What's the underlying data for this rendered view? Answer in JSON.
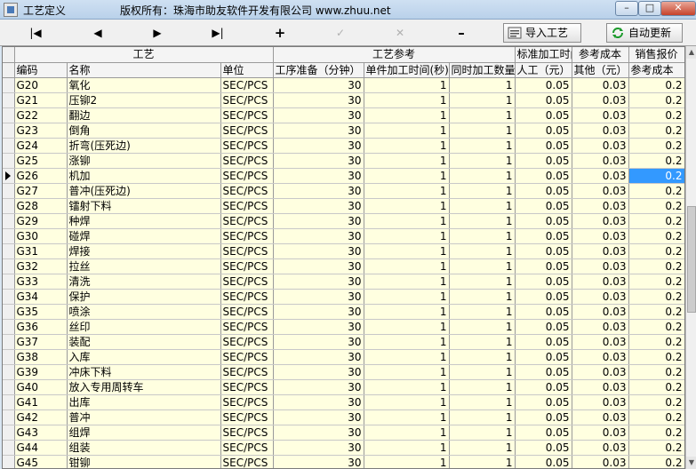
{
  "window": {
    "title": "工艺定义",
    "copyright": "版权所有：珠海市助友软件开发有限公司 www.zhuu.net",
    "minimize": "–",
    "maximize": "□",
    "close": "✕"
  },
  "toolbar": {
    "first": "|◀",
    "prev": "◀",
    "next": "▶",
    "last": "▶|",
    "add": "+",
    "edit": "✓",
    "cancel": "✕",
    "delete": "–",
    "import_label": "导入工艺",
    "refresh_label": "自动更新"
  },
  "header": {
    "group_craft": "工艺",
    "group_ref": "工艺参考",
    "group_std_time": "标准加工时间",
    "group_ref_cost": "参考成本",
    "group_sale": "销售报价",
    "col_code": "编码",
    "col_name": "名称",
    "col_unit": "单位",
    "col_prep": "工序准备（分钟）",
    "col_unit_time": "单件加工时间(秒)",
    "col_concurrent": "同时加工数量",
    "col_labor": "人工（元）",
    "col_other": "其他（元）",
    "col_ref_cost": "参考成本"
  },
  "rows": [
    {
      "code": "G20",
      "name": "氧化",
      "unit": "SEC/PCS",
      "prep": "30",
      "time": "1",
      "qty": "1",
      "labor": "0.05",
      "other": "0.03",
      "cost": "0.2"
    },
    {
      "code": "G21",
      "name": "压铆2",
      "unit": "SEC/PCS",
      "prep": "30",
      "time": "1",
      "qty": "1",
      "labor": "0.05",
      "other": "0.03",
      "cost": "0.2"
    },
    {
      "code": "G22",
      "name": "翻边",
      "unit": "SEC/PCS",
      "prep": "30",
      "time": "1",
      "qty": "1",
      "labor": "0.05",
      "other": "0.03",
      "cost": "0.2"
    },
    {
      "code": "G23",
      "name": "倒角",
      "unit": "SEC/PCS",
      "prep": "30",
      "time": "1",
      "qty": "1",
      "labor": "0.05",
      "other": "0.03",
      "cost": "0.2"
    },
    {
      "code": "G24",
      "name": "折弯(压死边)",
      "unit": "SEC/PCS",
      "prep": "30",
      "time": "1",
      "qty": "1",
      "labor": "0.05",
      "other": "0.03",
      "cost": "0.2"
    },
    {
      "code": "G25",
      "name": "涨铆",
      "unit": "SEC/PCS",
      "prep": "30",
      "time": "1",
      "qty": "1",
      "labor": "0.05",
      "other": "0.03",
      "cost": "0.2"
    },
    {
      "code": "G26",
      "name": "机加",
      "unit": "SEC/PCS",
      "prep": "30",
      "time": "1",
      "qty": "1",
      "labor": "0.05",
      "other": "0.03",
      "cost": "0.2"
    },
    {
      "code": "G27",
      "name": "普冲(压死边)",
      "unit": "SEC/PCS",
      "prep": "30",
      "time": "1",
      "qty": "1",
      "labor": "0.05",
      "other": "0.03",
      "cost": "0.2"
    },
    {
      "code": "G28",
      "name": "镭射下料",
      "unit": "SEC/PCS",
      "prep": "30",
      "time": "1",
      "qty": "1",
      "labor": "0.05",
      "other": "0.03",
      "cost": "0.2"
    },
    {
      "code": "G29",
      "name": "种焊",
      "unit": "SEC/PCS",
      "prep": "30",
      "time": "1",
      "qty": "1",
      "labor": "0.05",
      "other": "0.03",
      "cost": "0.2"
    },
    {
      "code": "G30",
      "name": "碰焊",
      "unit": "SEC/PCS",
      "prep": "30",
      "time": "1",
      "qty": "1",
      "labor": "0.05",
      "other": "0.03",
      "cost": "0.2"
    },
    {
      "code": "G31",
      "name": "焊接",
      "unit": "SEC/PCS",
      "prep": "30",
      "time": "1",
      "qty": "1",
      "labor": "0.05",
      "other": "0.03",
      "cost": "0.2"
    },
    {
      "code": "G32",
      "name": "拉丝",
      "unit": "SEC/PCS",
      "prep": "30",
      "time": "1",
      "qty": "1",
      "labor": "0.05",
      "other": "0.03",
      "cost": "0.2"
    },
    {
      "code": "G33",
      "name": "清洗",
      "unit": "SEC/PCS",
      "prep": "30",
      "time": "1",
      "qty": "1",
      "labor": "0.05",
      "other": "0.03",
      "cost": "0.2"
    },
    {
      "code": "G34",
      "name": "保护",
      "unit": "SEC/PCS",
      "prep": "30",
      "time": "1",
      "qty": "1",
      "labor": "0.05",
      "other": "0.03",
      "cost": "0.2"
    },
    {
      "code": "G35",
      "name": "喷涂",
      "unit": "SEC/PCS",
      "prep": "30",
      "time": "1",
      "qty": "1",
      "labor": "0.05",
      "other": "0.03",
      "cost": "0.2"
    },
    {
      "code": "G36",
      "name": "丝印",
      "unit": "SEC/PCS",
      "prep": "30",
      "time": "1",
      "qty": "1",
      "labor": "0.05",
      "other": "0.03",
      "cost": "0.2"
    },
    {
      "code": "G37",
      "name": "装配",
      "unit": "SEC/PCS",
      "prep": "30",
      "time": "1",
      "qty": "1",
      "labor": "0.05",
      "other": "0.03",
      "cost": "0.2"
    },
    {
      "code": "G38",
      "name": "入库",
      "unit": "SEC/PCS",
      "prep": "30",
      "time": "1",
      "qty": "1",
      "labor": "0.05",
      "other": "0.03",
      "cost": "0.2"
    },
    {
      "code": "G39",
      "name": "冲床下料",
      "unit": "SEC/PCS",
      "prep": "30",
      "time": "1",
      "qty": "1",
      "labor": "0.05",
      "other": "0.03",
      "cost": "0.2"
    },
    {
      "code": "G40",
      "name": "放入专用周转车",
      "unit": "SEC/PCS",
      "prep": "30",
      "time": "1",
      "qty": "1",
      "labor": "0.05",
      "other": "0.03",
      "cost": "0.2"
    },
    {
      "code": "G41",
      "name": "出库",
      "unit": "SEC/PCS",
      "prep": "30",
      "time": "1",
      "qty": "1",
      "labor": "0.05",
      "other": "0.03",
      "cost": "0.2"
    },
    {
      "code": "G42",
      "name": "普冲",
      "unit": "SEC/PCS",
      "prep": "30",
      "time": "1",
      "qty": "1",
      "labor": "0.05",
      "other": "0.03",
      "cost": "0.2"
    },
    {
      "code": "G43",
      "name": "组焊",
      "unit": "SEC/PCS",
      "prep": "30",
      "time": "1",
      "qty": "1",
      "labor": "0.05",
      "other": "0.03",
      "cost": "0.2"
    },
    {
      "code": "G44",
      "name": "组装",
      "unit": "SEC/PCS",
      "prep": "30",
      "time": "1",
      "qty": "1",
      "labor": "0.05",
      "other": "0.03",
      "cost": "0.2"
    },
    {
      "code": "G45",
      "name": "钳铆",
      "unit": "SEC/PCS",
      "prep": "30",
      "time": "1",
      "qty": "1",
      "labor": "0.05",
      "other": "0.03",
      "cost": "0.2"
    }
  ],
  "selected_row_code": "G26",
  "colors": {
    "grid_background": "#ffffe0",
    "selection": "#3399ff"
  }
}
